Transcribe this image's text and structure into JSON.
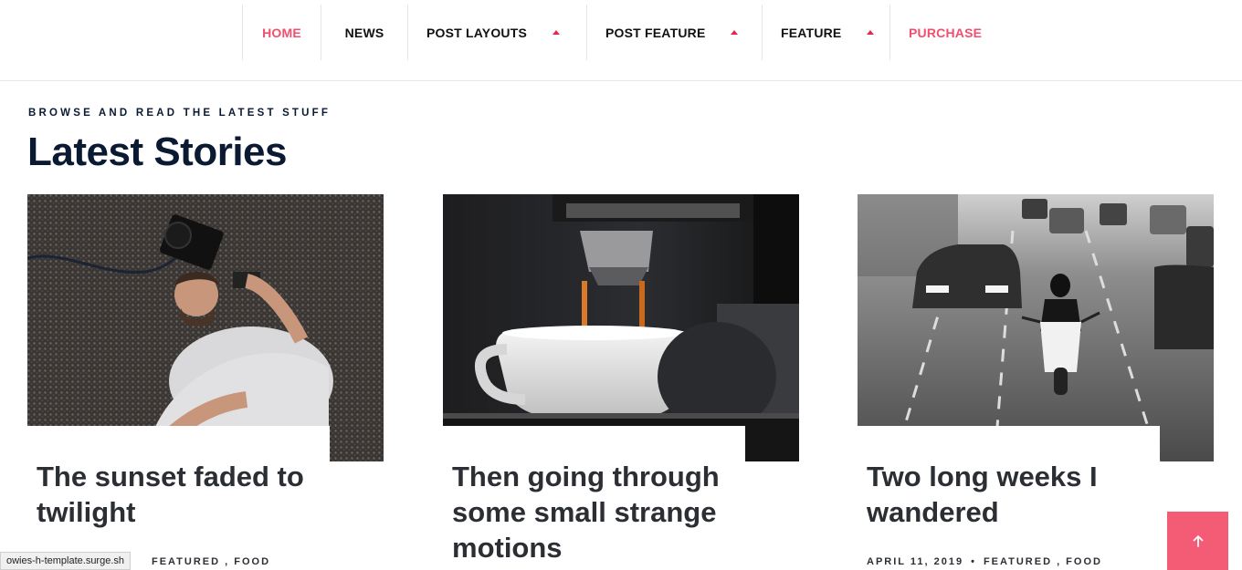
{
  "nav": {
    "items": [
      {
        "label": "HOME",
        "active": true,
        "dropdown": false
      },
      {
        "label": "NEWS",
        "active": false,
        "dropdown": false
      },
      {
        "label": "POST LAYOUTS",
        "active": false,
        "dropdown": true
      },
      {
        "label": "POST FEATURE",
        "active": false,
        "dropdown": true
      },
      {
        "label": "FEATURE",
        "active": false,
        "dropdown": true
      },
      {
        "label": "PURCHASE",
        "active": false,
        "dropdown": false
      }
    ]
  },
  "section": {
    "eyebrow": "BROWSE AND READ THE LATEST STUFF",
    "title": "Latest Stories"
  },
  "cards": [
    {
      "title": "The sunset faded to twilight",
      "date": "",
      "categories": "FEATURED , FOOD",
      "image": "man-on-carpet-photo"
    },
    {
      "title": "Then going through some small strange motions",
      "date": "",
      "categories": "",
      "image": "espresso-machine-photo"
    },
    {
      "title": "Two long weeks I wandered",
      "date": "APRIL 11, 2019",
      "categories": "FEATURED , FOOD",
      "image": "scooter-traffic-photo"
    }
  ],
  "status_url": "owies-h-template.surge.sh",
  "colors": {
    "accent": "#f0506e",
    "caret": "#e8264a",
    "to_top": "#f45b74",
    "heading": "#0b1a33",
    "card_title": "#2b2f33"
  },
  "icons": {
    "to_top": "arrow-up-icon",
    "caret": "caret-up-icon"
  }
}
